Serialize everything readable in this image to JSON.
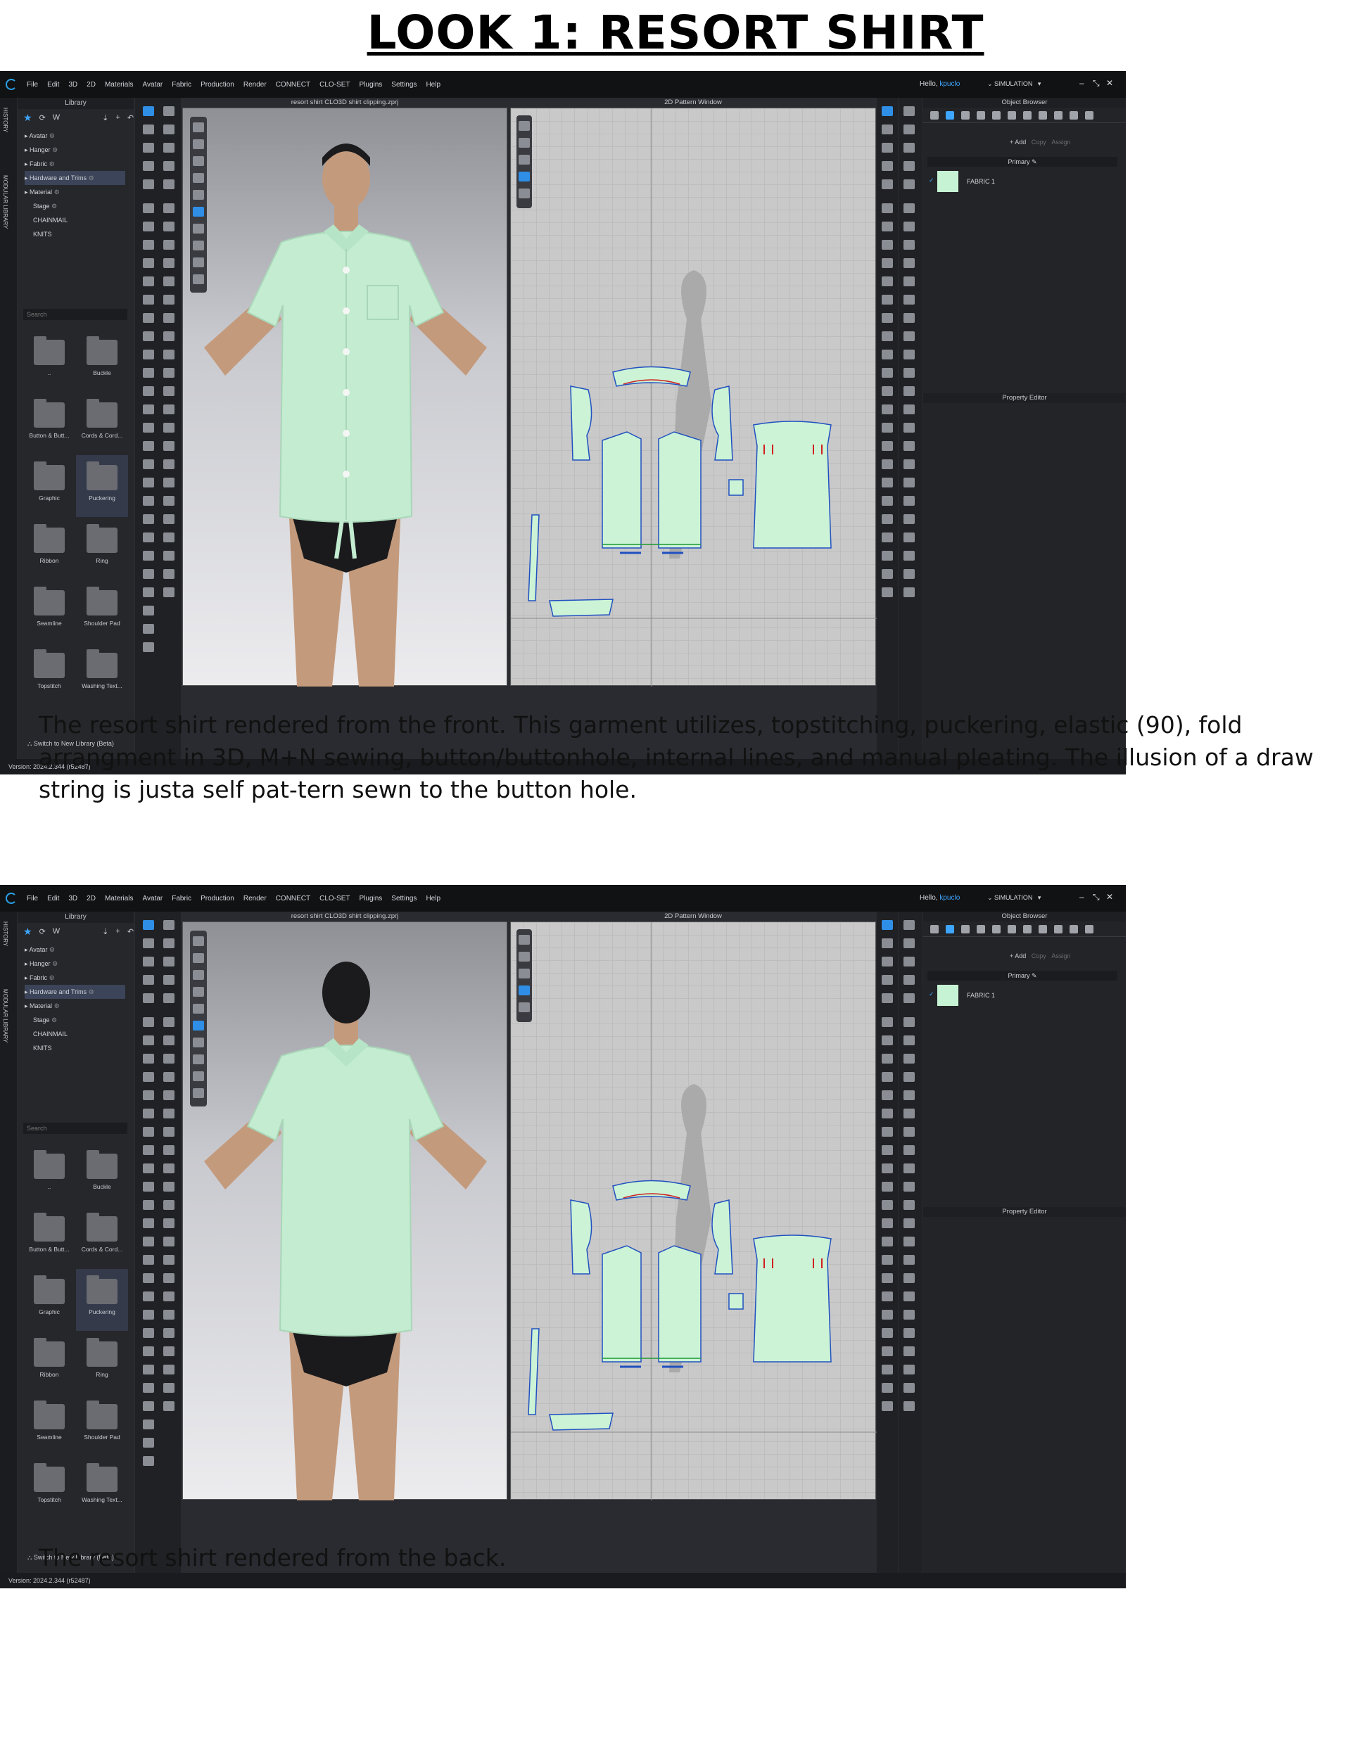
{
  "page_title": "LOOK 1: RESORT SHIRT",
  "captions": [
    "The resort shirt rendered from the front. This garment utilizes, topstitching, puckering, elastic (90), fold arrangment in 3D, M+N sewing, button/buttonhole, internal lines, and manual pleating. The illusion of a draw string is justa self pat-tern sewn to the button hole.",
    "The resort shirt rendered from the back."
  ],
  "app": {
    "menu": [
      "File",
      "Edit",
      "3D",
      "2D",
      "Materials",
      "Avatar",
      "Fabric",
      "Production",
      "Render",
      "CONNECT",
      "CLO-SET",
      "Plugins",
      "Settings",
      "Help"
    ],
    "hello": "Hello,",
    "user": "kpuclo",
    "simulation": "SIMULATION",
    "side_tabs": [
      "HISTORY",
      "MODULAR LIBRARY"
    ],
    "library": {
      "title": "Library",
      "tree": [
        {
          "label": "Avatar",
          "level": 0,
          "selected": false
        },
        {
          "label": "Hanger",
          "level": 0,
          "selected": false
        },
        {
          "label": "Fabric",
          "level": 0,
          "selected": false
        },
        {
          "label": "Hardware and Trims",
          "level": 0,
          "selected": true
        },
        {
          "label": "Material",
          "level": 0,
          "selected": false
        },
        {
          "label": "Stage",
          "level": 1,
          "selected": false
        },
        {
          "label": "CHAINMAIL",
          "level": 1,
          "selected": false
        },
        {
          "label": "KNITS",
          "level": 1,
          "selected": false
        }
      ],
      "search_placeholder": "Search",
      "folders": [
        "..",
        "Buckle",
        "Button & Butt...",
        "Cords & Cord...",
        "Graphic",
        "Puckering",
        "Ribbon",
        "Ring",
        "Seamline",
        "Shoulder Pad",
        "Topstitch",
        "Washing Text..."
      ],
      "selected_folder": "Puckering",
      "switch_label": "Switch to New Library (Beta)"
    },
    "viewport_title": "resort shirt CLO3D shirt clipping.zprj",
    "pattern_title": "2D Pattern Window",
    "object_browser": {
      "title": "Object Browser",
      "add": "+ Add",
      "copy": "Copy",
      "assign": "Assign",
      "group": "Primary",
      "fabric": "FABRIC 1",
      "fabric_color": "#c7f3d5"
    },
    "property_editor": "Property Editor",
    "version": "Version: 2024.2.344 (r52487)",
    "accent": "#3ea6ff",
    "shirt_color": "#c3ecd0"
  }
}
